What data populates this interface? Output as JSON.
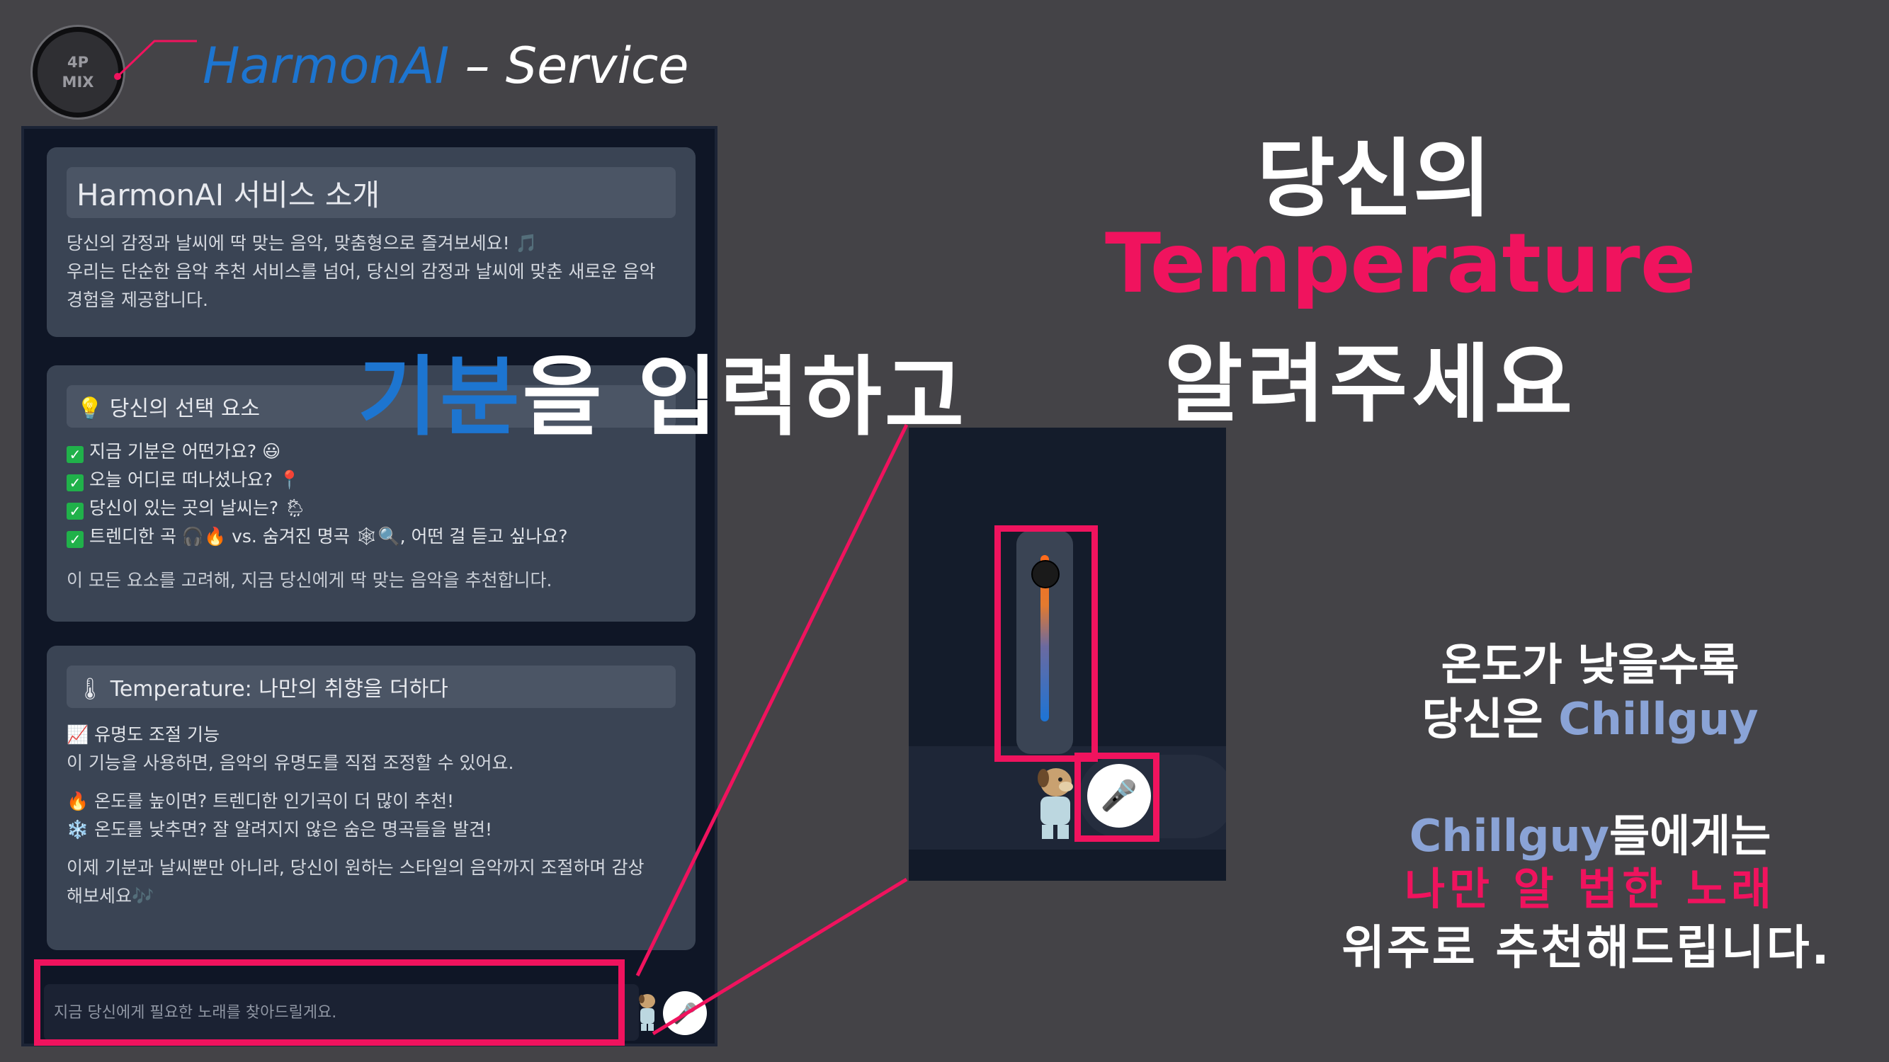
{
  "logo": {
    "line1": "4P",
    "line2": "MIX"
  },
  "brand": {
    "part1": "HarmonAI",
    "part2": " – Service"
  },
  "card1": {
    "title": "HarmonAI 서비스 소개",
    "line1": "당신의 감정과 날씨에 딱 맞는 음악, 맞춤형으로 즐겨보세요! 🎵",
    "line2": "우리는 단순한 음악 추천 서비스를 넘어, 당신의 감정과 날씨에 맞춘 새로운 음악",
    "line3": "경험을 제공합니다."
  },
  "card2": {
    "title": "💡 당신의 선택 요소",
    "items": [
      "지금 기분은 어떤가요? 😃",
      "오늘 어디로 떠나셨나요? 📍",
      "당신이 있는 곳의 날씨는? 🌦",
      "트렌디한 곡 🎧🔥 vs. 숨겨진 명곡 🕸🔍, 어떤 걸 듣고 싶나요?"
    ],
    "note": "이 모든 요소를 고려해, 지금 당신에게 딱 맞는 음악을 추천합니다."
  },
  "card3": {
    "title": "🌡 Temperature: 나만의 취향을 더하다",
    "sub": "📈 유명도 조절 기능",
    "desc": "이 기능을 사용하면, 음악의 유명도를 직접 조정할 수 있어요.",
    "high": "🔥 온도를 높이면? 트렌디한 인기곡이 더 많이 추천!",
    "low": "❄️ 온도를 낮추면? 잘 알려지지 않은 숨은 명곡들을 발견!",
    "end1": "이제 기분과 날씨뿐만 아니라, 당신이 원하는 스타일의 음악까지 조절하며 감상",
    "end2": "해보세요🎶"
  },
  "input": {
    "placeholder": "지금 당신에게 필요한 노래를 찾아드릴게요."
  },
  "icons": {
    "mic": "microphone-icon",
    "mascot": "chillguy-mascot"
  },
  "captions": {
    "mood_accent": "기분",
    "mood_rest": "을 입력하고",
    "temp_l1": "당신의",
    "temp_l2": "Temperature",
    "temp_l3": "알려주세요",
    "s1": "온도가 낮을수록",
    "s2a": "당신은 ",
    "s2b": "Chillguy",
    "s3a": "Chillguy",
    "s3b": "들에게는",
    "s4": "나만 알 법한 노래",
    "s5": "위주로 추천해드립니다."
  },
  "temperature_slider": {
    "level": 0.1
  },
  "colors": {
    "accent_pink": "#f0135e",
    "accent_blue": "#1d75d0",
    "chill_blue": "#8aa3d6",
    "background": "#444347"
  }
}
